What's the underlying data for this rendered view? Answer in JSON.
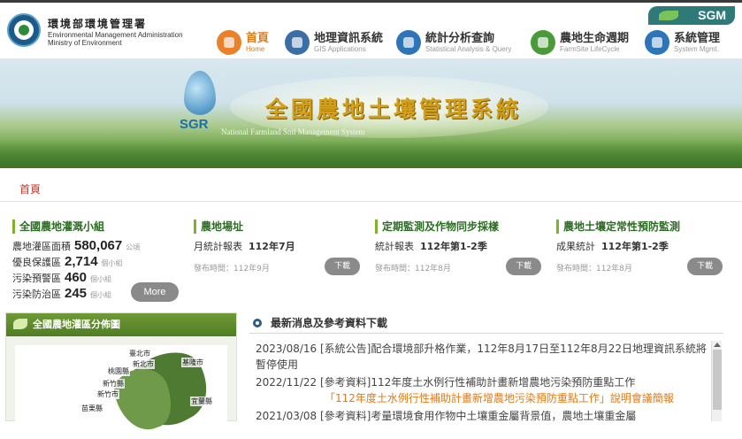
{
  "header": {
    "org_zh": "環境部環境管理署",
    "org_en_1": "Environmental Management Administration",
    "org_en_2": "Ministry of Environment",
    "badge": "SGM",
    "nav": [
      {
        "label": "首頁",
        "sub": "Home",
        "icon": "home-icon",
        "color": "#e8812a",
        "active": true
      },
      {
        "label": "地理資訊系統",
        "sub": "GIS Applications",
        "icon": "gis-icon",
        "color": "#3a6ea5",
        "active": false
      },
      {
        "label": "統計分析查詢",
        "sub": "Statistical Analysis & Query",
        "icon": "stats-icon",
        "color": "#2d74b8",
        "active": false
      },
      {
        "label": "農地生命週期",
        "sub": "FarmSite LifeCycle",
        "icon": "lifecycle-icon",
        "color": "#4a9a3a",
        "active": false
      },
      {
        "label": "系統管理",
        "sub": "System Mgmt.",
        "icon": "system-icon",
        "color": "#2d74b8",
        "active": false
      }
    ]
  },
  "banner": {
    "title": "全國農地土壤管理系統",
    "subtitle": "National Farmland Soil Management System",
    "logo_text": "SGR"
  },
  "breadcrumb": "首頁",
  "cards": {
    "irrigation": {
      "title": "全國農地灌溉小組",
      "stats": [
        {
          "label": "農地灌區面積",
          "value": "580,067",
          "unit": "公頃"
        },
        {
          "label": "優良保護區",
          "value": "2,714",
          "unit": "個小組"
        },
        {
          "label": "污染預警區",
          "value": "460",
          "unit": "個小組"
        },
        {
          "label": "污染防治區",
          "value": "245",
          "unit": "個小組"
        }
      ],
      "more": "More"
    },
    "farm": {
      "title": "農地場址",
      "row_label": "月統計報表",
      "row_value": "112年7月",
      "meta": "發布時間：112年9月",
      "download": "下載"
    },
    "monitor": {
      "title": "定期監測及作物同步採樣",
      "row_label": "統計報表",
      "row_value": "112年第1-2季",
      "meta": "發布時間：112年8月",
      "download": "下載"
    },
    "prevent": {
      "title": "農地土壤定常性預防監測",
      "row_label": "成果統計",
      "row_value": "112年第1-2季",
      "meta": "發布時間：112年8月",
      "download": "下載"
    }
  },
  "map_panel": {
    "title": "全國農地灌區分佈圖",
    "labels": [
      "臺北市",
      "新北市",
      "基隆市",
      "桃園縣",
      "新竹縣",
      "新竹市",
      "苗栗縣",
      "宜蘭縣"
    ]
  },
  "news": {
    "title": "最新消息及參考資料下載",
    "items": [
      {
        "text": "2023/08/16 [系統公告]配合環境部升格作業，112年8月17日至112年8月22日地理資訊系統將暫停使用",
        "link": ""
      },
      {
        "text": "2022/11/22 [參考資料]112年度土水例行性補助計畫新增農地污染預防重點工作",
        "link": "「112年度土水例行性補助計畫新增農地污染預防重點工作」說明會議簡報"
      },
      {
        "text": "2021/03/08 [參考資料]考量環境食用作物中土壤重金屬背景值，農地土壤重金屬",
        "link": ""
      }
    ]
  }
}
